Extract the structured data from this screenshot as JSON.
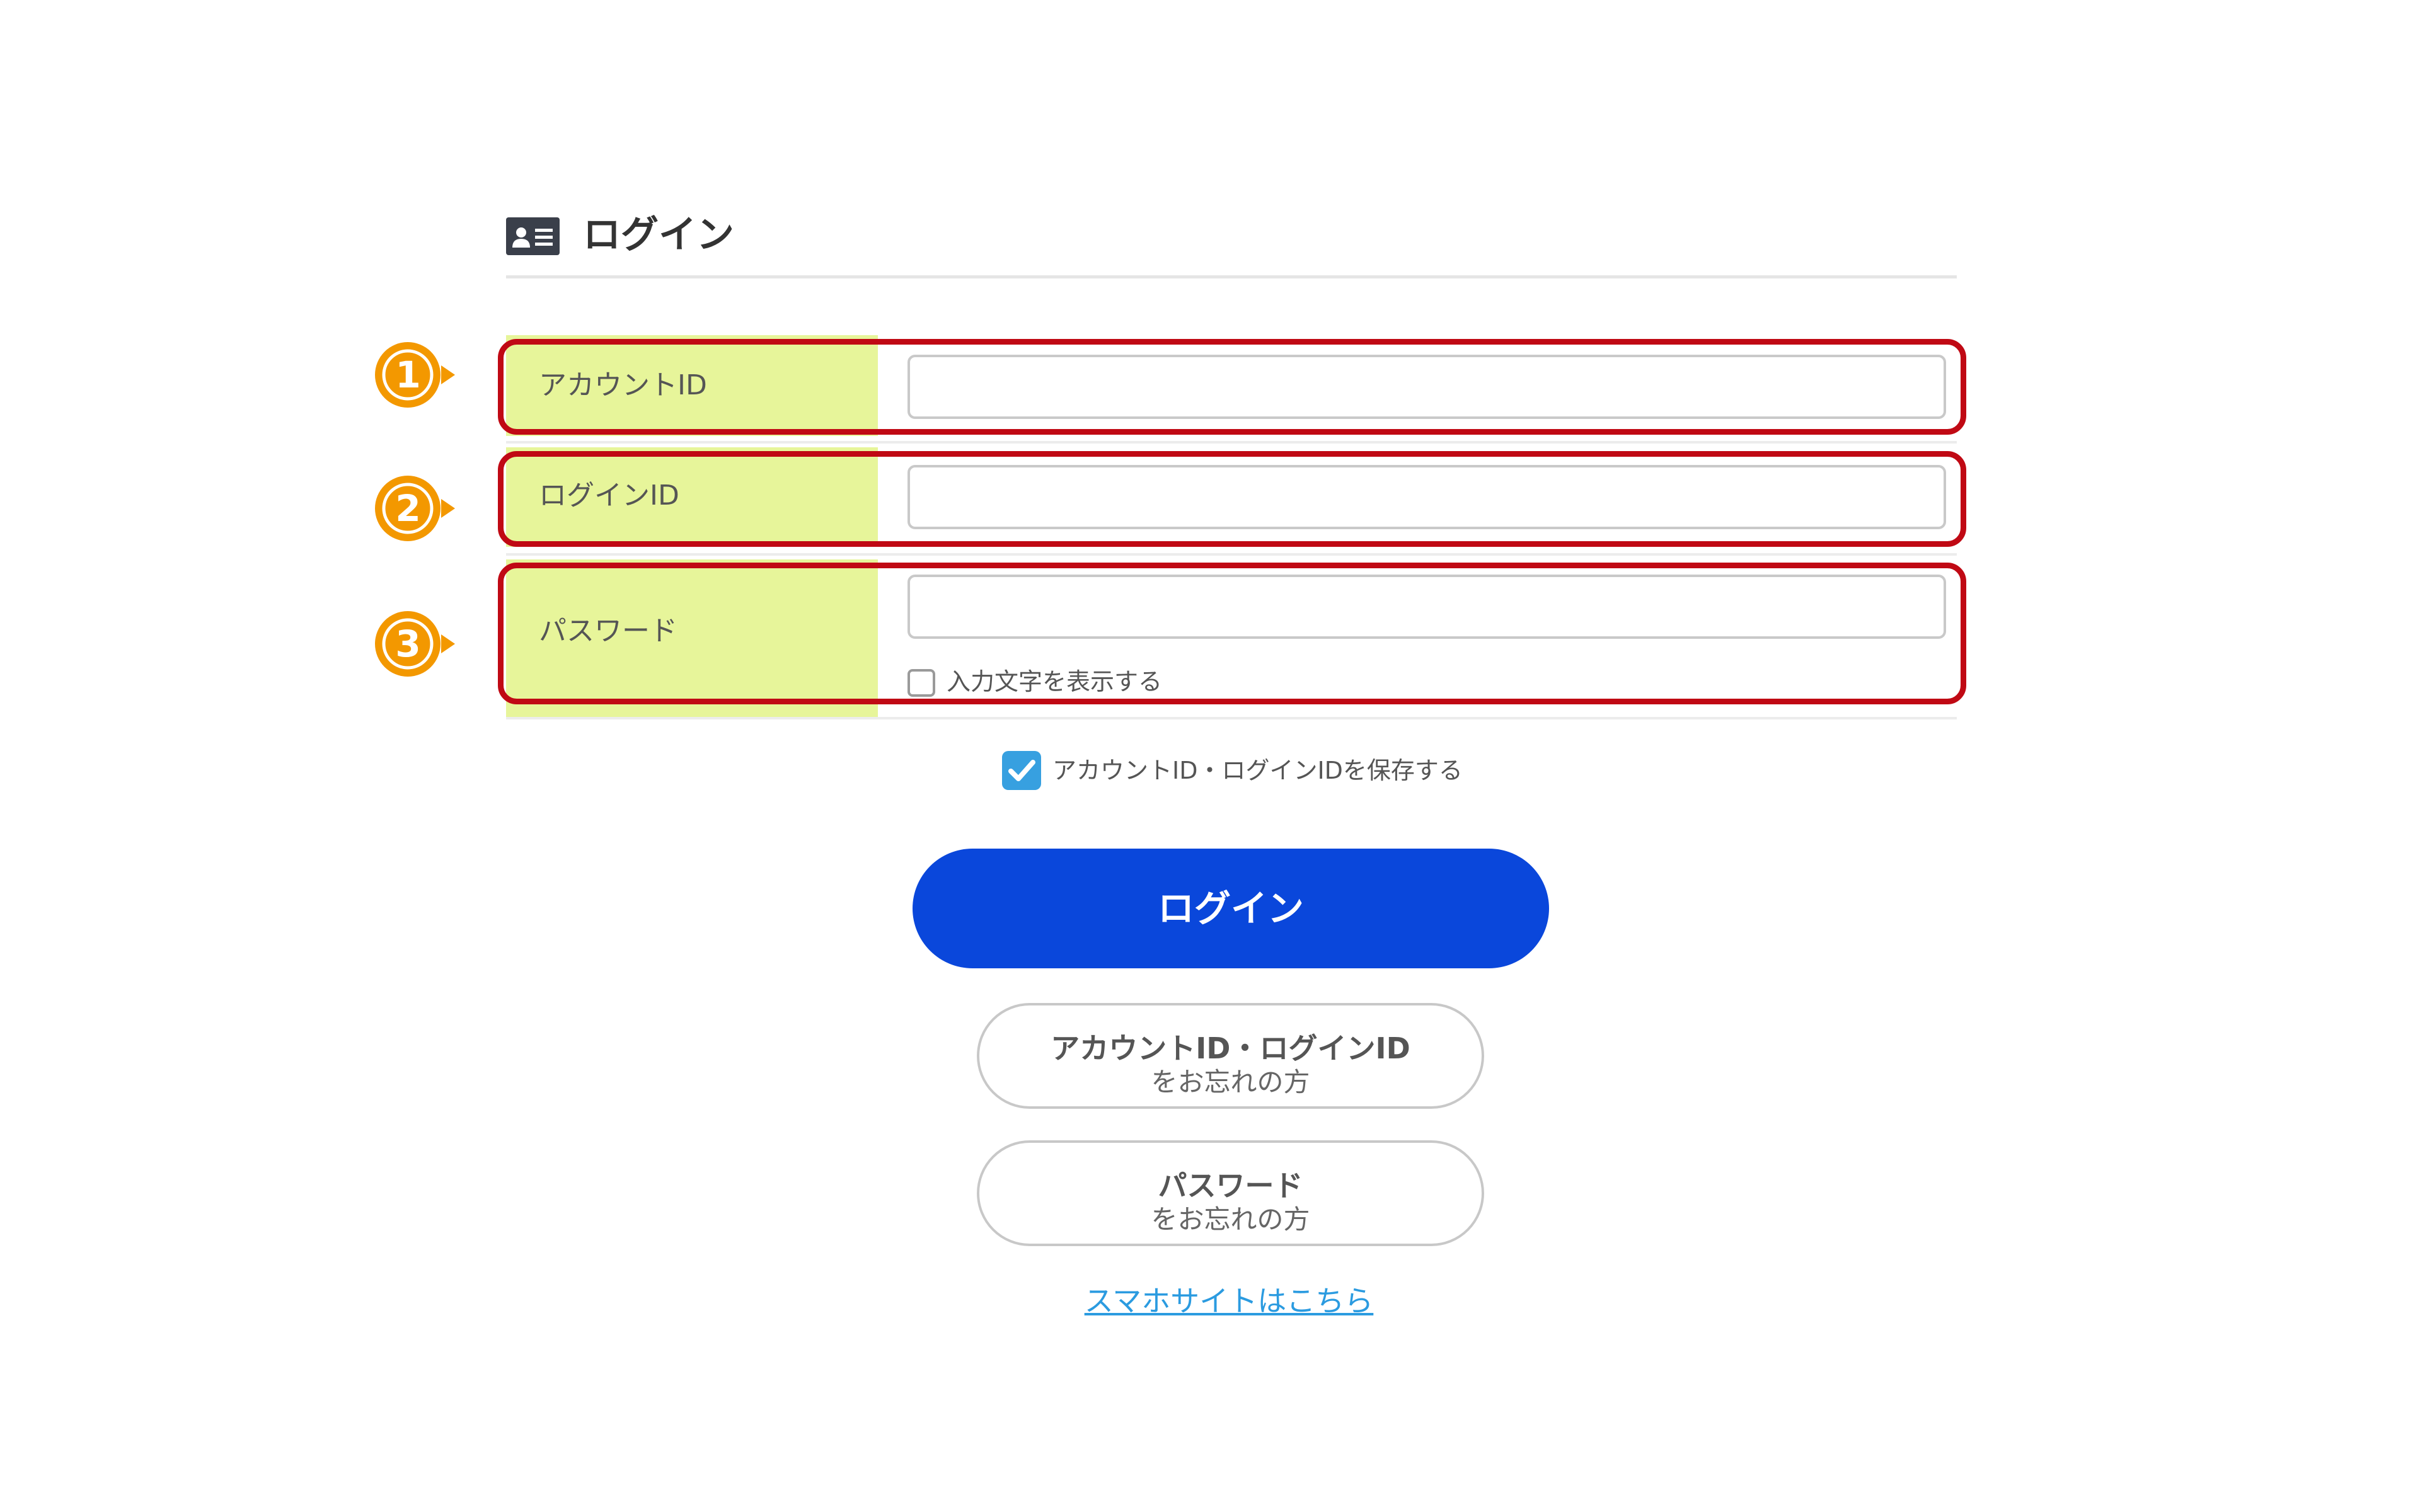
{
  "header": {
    "title": "ログイン",
    "icon": "id-card-icon"
  },
  "form": {
    "fields": [
      {
        "number": "1",
        "label": "アカウントID",
        "value": "",
        "placeholder": ""
      },
      {
        "number": "2",
        "label": "ログインID",
        "value": "",
        "placeholder": ""
      },
      {
        "number": "3",
        "label": "パスワード",
        "value": "",
        "placeholder": ""
      }
    ],
    "show_password_label": "入力文字を表示する",
    "show_password_checked": false,
    "save_label": "アカウントID・ログインIDを保存する",
    "save_checked": true
  },
  "buttons": {
    "login": "ログイン",
    "forgot_ids_line1": "アカウントID・ログインID",
    "forgot_ids_line2": "をお忘れの方",
    "forgot_password_line1": "パスワード",
    "forgot_password_line2": "をお忘れの方"
  },
  "links": {
    "smartphone_site": "スマホサイトはこちら"
  },
  "colors": {
    "label_background": "#e7f59a",
    "highlight_border": "#c00914",
    "callout": "#f39800",
    "login_button": "#0a47db",
    "checkbox": "#37a0e0",
    "link": "#2b9be0"
  }
}
